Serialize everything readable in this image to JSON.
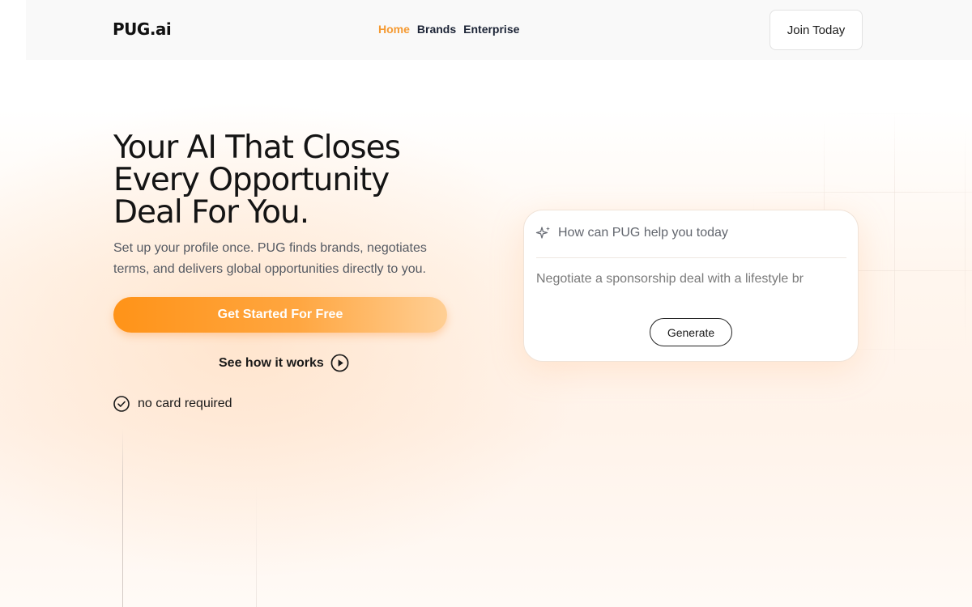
{
  "header": {
    "logo": "PUG.ai",
    "nav": [
      {
        "label": "Home",
        "active": true
      },
      {
        "label": "Brands",
        "active": false
      },
      {
        "label": "Enterprise",
        "active": false
      }
    ],
    "join_label": "Join Today"
  },
  "hero": {
    "headline_lines": [
      "Your AI That Closes",
      "Every Opportunity",
      "Deal For You."
    ],
    "subtext": "Set up your profile once. PUG finds brands, negotiates terms, and delivers global opportunities directly to you.",
    "cta_label": "Get Started For Free",
    "see_how_label": "See how it works",
    "no_card_label": "no card required"
  },
  "prompt_card": {
    "title": "How can PUG help you today",
    "input_value": "Negotiate a sponsorship deal with a lifestyle br",
    "generate_label": "Generate"
  },
  "colors": {
    "accent": "#f59a32",
    "cta_start": "#ff9318",
    "cta_end": "#ffcf95",
    "nav_text": "#1c2436"
  },
  "icons": {
    "sparkle": "sparkle-icon",
    "play": "play-circle-icon",
    "check": "check-circle-icon"
  }
}
